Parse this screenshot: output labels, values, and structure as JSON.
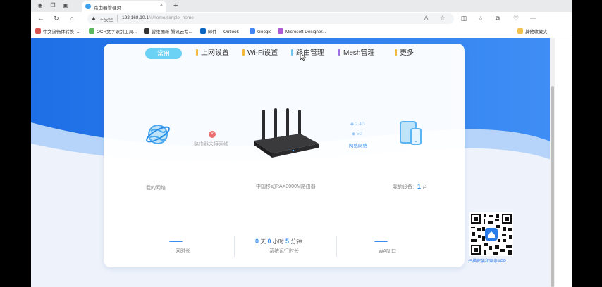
{
  "browser": {
    "tab_title": "路由器管理页",
    "tab_close": "×",
    "new_tab": "+",
    "insecure_label": "不安全",
    "url_host": "192.168.10.1",
    "url_path": "/#/home/simple_home",
    "read_aloud": "A",
    "bookmarks": [
      {
        "label": "中文流畅体转换 -...",
        "color": "#d9534f"
      },
      {
        "label": "OCR文字识别工具...",
        "color": "#5cb85c"
      },
      {
        "label": "曾维图新·腾讯云专...",
        "color": "#333333"
      },
      {
        "label": "邮件 - - Outlook",
        "color": "#0a66c2"
      },
      {
        "label": "Google",
        "color": "#4285f4"
      },
      {
        "label": "Microsoft Designer...",
        "color": "#b05cd9"
      }
    ],
    "other_bookmarks": "其他收藏夹"
  },
  "router_ui": {
    "menu": {
      "home": "常用",
      "internet": "上网设置",
      "wifi": "Wi-Fi设置",
      "router_mgmt": "路由管理",
      "mesh": "Mesh管理",
      "more": "更多"
    },
    "colors": {
      "internet": "#f6b73c",
      "wifi": "#f6b73c",
      "router_mgmt": "#6cc4f0",
      "mesh": "#9b6fe0",
      "more": "#f6b73c",
      "accent": "#3b8df0"
    },
    "status": {
      "disconnected": "路由器未接网线",
      "my_network": "我的网络",
      "router_model": "中国移动RAX3000M路由器",
      "wifi_24": "2.4G",
      "wifi_5": "5G",
      "wifi_link": "网络网络",
      "my_devices_label": "我的设备：",
      "my_devices_count": "1",
      "my_devices_unit": "台"
    },
    "stats": {
      "online_value": "---------",
      "online_label": "上网时长",
      "days": "0",
      "days_unit": "天",
      "hours": "0",
      "hours_unit": "小时",
      "minutes": "5",
      "minutes_unit": "分钟",
      "runtime_label": "系统运行时长",
      "wan_value": "---------",
      "wan_label": "WAN 口"
    },
    "qr_caption": "扫描安装和家亲APP"
  }
}
